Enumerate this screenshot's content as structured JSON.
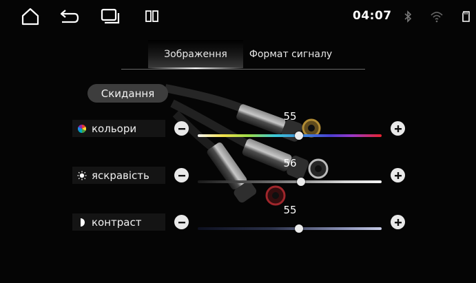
{
  "status_bar": {
    "home_icon": "home-outline-icon",
    "back_icon": "return-arrow-icon",
    "recents_icon": "stacked-windows-icon",
    "split_icon": "split-screen-icon",
    "clock": "04:07",
    "bluetooth_icon": "bluetooth-icon",
    "wifi_icon": "wifi-icon",
    "sd_icon": "sd-card-icon"
  },
  "tabs": [
    {
      "label": "Зображення",
      "active": true
    },
    {
      "label": "Формат сигналу",
      "active": false
    }
  ],
  "reset_label": "Скидання",
  "settings": [
    {
      "key": "color",
      "label": "кольори",
      "icon": "color-wheel-icon",
      "value": "55",
      "level": 0.55
    },
    {
      "key": "brightness",
      "label": "яскравість",
      "icon": "sun-icon",
      "value": "56",
      "level": 0.56
    },
    {
      "key": "contrast",
      "label": "контраст",
      "icon": "half-circle-icon",
      "value": "55",
      "level": 0.55
    }
  ],
  "colors": {
    "background": "#050505",
    "button_bg": "#3d3d3d",
    "label_bg": "#141414",
    "control_fg": "#e9e9e9"
  }
}
